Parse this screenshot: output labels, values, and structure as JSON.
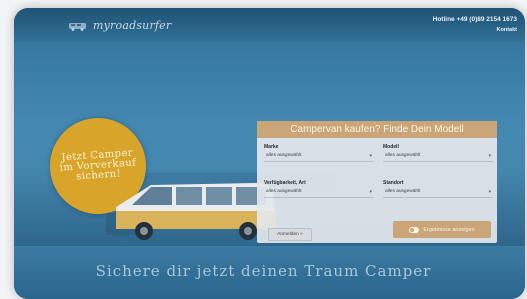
{
  "header": {
    "logo_text": "myroadsurfer",
    "hotline": "Hotline +49 (0)89 2154 1673",
    "contact": "Kontakt"
  },
  "badge": {
    "lines": [
      "Jetzt Camper",
      "im Vorverkauf",
      "sichern!"
    ]
  },
  "search_panel": {
    "title": "Campervan kaufen? Finde Dein Modell",
    "fields": [
      {
        "label": "Marke",
        "value": "alles ausgewählt"
      },
      {
        "label": "Modell",
        "value": "alles ausgewählt"
      },
      {
        "label": "Verfügbarkeit, Art",
        "value": "alles ausgewählt"
      },
      {
        "label": "Standort",
        "value": "alles ausgewählt"
      }
    ],
    "reset_label": "Anmelden »",
    "submit_label": "Ergebnisse anzeigen"
  },
  "banner": {
    "text": "Sichere dir jetzt deinen Traum Camper"
  },
  "colors": {
    "accent": "#c9a577",
    "badge": "#d8a52a",
    "background": "#3f83ab"
  },
  "icons": {
    "logo": "van-icon",
    "chevron": "chevron-down-icon",
    "toggle": "toggle-icon"
  }
}
